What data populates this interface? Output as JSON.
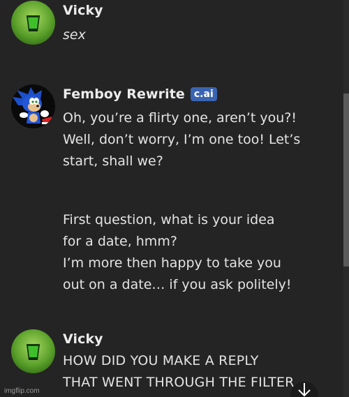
{
  "messages": [
    {
      "author": "Vicky",
      "avatar": "green-drink-icon",
      "lines": [
        "sex"
      ],
      "italic": true
    },
    {
      "author": "Femboy Rewrite",
      "badge": "c.ai",
      "avatar": "sonic-character-icon",
      "paragraph1": "Oh, you’re a flirty one, aren’t you?!\nWell, don’t worry, I’m one too! Let’s\nstart, shall we?",
      "paragraph2": "First question, what is your idea\nfor a date, hmm?\nI’m more then happy to take you\nout on a date… if you ask politely!"
    },
    {
      "author": "Vicky",
      "avatar": "green-drink-icon",
      "text": "HOW DID YOU MAKE A REPLY\nTHAT WENT THROUGH THE FILTER"
    }
  ],
  "watermark": "imgflip.com",
  "colors": {
    "background": "#242424",
    "badge": "#3a64b2",
    "avatar_green": "#5aa02a"
  }
}
